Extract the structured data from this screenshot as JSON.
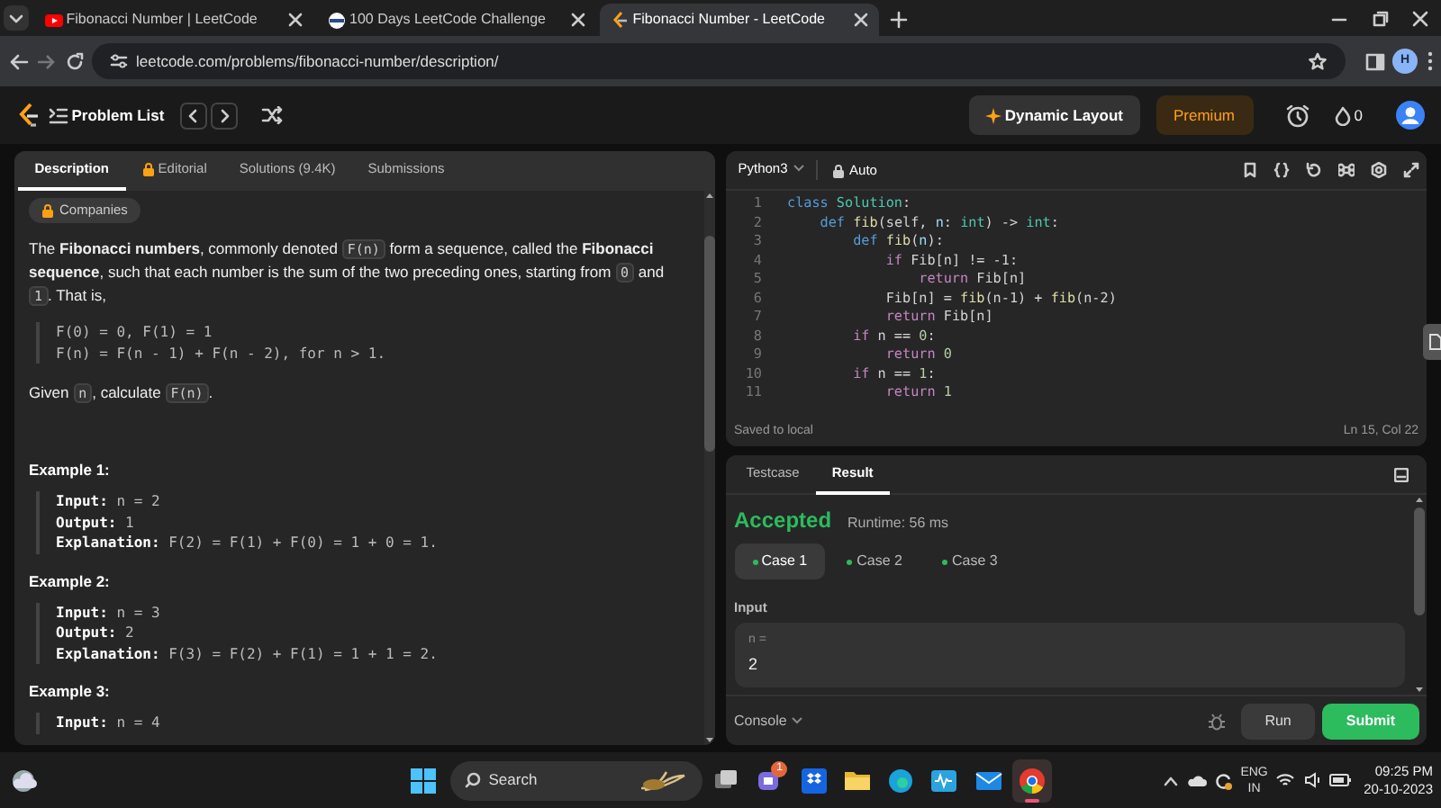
{
  "browser": {
    "tabs": [
      {
        "title": "Fibonacci Number | LeetCode",
        "kind": "video",
        "selected": false
      },
      {
        "title": "100 Days LeetCode Challenge",
        "kind": "globe",
        "selected": false
      },
      {
        "title": "Fibonacci Number - LeetCode",
        "kind": "leetcode",
        "selected": true
      }
    ],
    "url": "leetcode.com/problems/fibonacci-number/description/",
    "profile": "H"
  },
  "header": {
    "problem_list": "Problem List",
    "dynamic_layout": "Dynamic Layout",
    "premium": "Premium",
    "streak": "0"
  },
  "description": {
    "tabs": [
      {
        "label": "Description",
        "locked": false,
        "selected": true
      },
      {
        "label": "Editorial",
        "locked": true,
        "selected": false
      },
      {
        "label": "Solutions (9.4K)",
        "locked": false,
        "selected": false
      },
      {
        "label": "Submissions",
        "locked": false,
        "selected": false
      }
    ],
    "companies": "Companies",
    "intro": [
      {
        "kind": "text",
        "text": "The **Fibonacci numbers**, commonly denoted "
      },
      {
        "kind": "code",
        "text": "F(n)"
      },
      {
        "kind": "text",
        "text": " form a sequence, called the **Fibonacci sequence**, such that each number is the sum of the two preceding ones, starting from "
      },
      {
        "kind": "code",
        "text": "0"
      },
      {
        "kind": "text",
        "text": " and "
      },
      {
        "kind": "code",
        "text": "1"
      },
      {
        "kind": "text",
        "text": ". That is,"
      }
    ],
    "formula": [
      "F(0) = 0, F(1) = 1",
      "F(n) = F(n - 1) + F(n - 2), for n > 1."
    ],
    "given": [
      {
        "kind": "text",
        "text": "Given "
      },
      {
        "kind": "code",
        "text": "n"
      },
      {
        "kind": "text",
        "text": ", calculate "
      },
      {
        "kind": "code",
        "text": "F(n)"
      },
      {
        "kind": "text",
        "text": "."
      }
    ],
    "examples": [
      {
        "title": "Example 1:",
        "lines": [
          {
            "label": "Input:",
            "value": "n = 2"
          },
          {
            "label": "Output:",
            "value": "1"
          },
          {
            "label": "Explanation:",
            "value": "F(2) = F(1) + F(0) = 1 + 0 = 1."
          }
        ]
      },
      {
        "title": "Example 2:",
        "lines": [
          {
            "label": "Input:",
            "value": "n = 3"
          },
          {
            "label": "Output:",
            "value": "2"
          },
          {
            "label": "Explanation:",
            "value": "F(3) = F(2) + F(1) = 1 + 1 = 2."
          }
        ]
      },
      {
        "title": "Example 3:",
        "lines": [
          {
            "label": "Input:",
            "value": "n = 4"
          }
        ]
      }
    ]
  },
  "editor": {
    "language": "Python3",
    "mode": "Auto",
    "lines": [
      {
        "number": "1",
        "tokens": [
          {
            "kind": "storage",
            "text": "class"
          },
          {
            "kind": "class",
            "text": " Solution"
          },
          {
            "kind": "plain",
            "text": ":"
          }
        ]
      },
      {
        "number": "2",
        "tokens": [
          {
            "kind": "storage",
            "text": "    def"
          },
          {
            "kind": "func",
            "text": " fib"
          },
          {
            "kind": "plain",
            "text": "(self, "
          },
          {
            "kind": "var",
            "text": "n"
          },
          {
            "kind": "plain",
            "text": ": "
          },
          {
            "kind": "class",
            "text": "int"
          },
          {
            "kind": "plain",
            "text": ") -> "
          },
          {
            "kind": "class",
            "text": "int"
          },
          {
            "kind": "plain",
            "text": ":"
          }
        ]
      },
      {
        "number": "3",
        "tokens": [
          {
            "kind": "storage",
            "text": "        def"
          },
          {
            "kind": "func",
            "text": " fib"
          },
          {
            "kind": "plain",
            "text": "("
          },
          {
            "kind": "var",
            "text": "n"
          },
          {
            "kind": "plain",
            "text": "):"
          }
        ]
      },
      {
        "number": "4",
        "tokens": [
          {
            "kind": "control",
            "text": "            if"
          },
          {
            "kind": "plain",
            "text": " Fib[n] != -1:"
          }
        ]
      },
      {
        "number": "5",
        "tokens": [
          {
            "kind": "control",
            "text": "                return"
          },
          {
            "kind": "plain",
            "text": " Fib[n]"
          }
        ]
      },
      {
        "number": "6",
        "tokens": [
          {
            "kind": "plain",
            "text": "            Fib[n] = "
          },
          {
            "kind": "func",
            "text": "fib"
          },
          {
            "kind": "plain",
            "text": "(n-1) + "
          },
          {
            "kind": "func",
            "text": "fib"
          },
          {
            "kind": "plain",
            "text": "(n-2)"
          }
        ]
      },
      {
        "number": "7",
        "tokens": [
          {
            "kind": "control",
            "text": "            return"
          },
          {
            "kind": "plain",
            "text": " Fib[n]"
          }
        ]
      },
      {
        "number": "8",
        "tokens": [
          {
            "kind": "control",
            "text": "        if"
          },
          {
            "kind": "plain",
            "text": " n == "
          },
          {
            "kind": "num",
            "text": "0"
          },
          {
            "kind": "plain",
            "text": ":"
          }
        ]
      },
      {
        "number": "9",
        "tokens": [
          {
            "kind": "control",
            "text": "            return"
          },
          {
            "kind": "num",
            "text": " 0"
          }
        ]
      },
      {
        "number": "10",
        "tokens": [
          {
            "kind": "control",
            "text": "        if"
          },
          {
            "kind": "plain",
            "text": " n == "
          },
          {
            "kind": "num",
            "text": "1"
          },
          {
            "kind": "plain",
            "text": ":"
          }
        ]
      },
      {
        "number": "11",
        "tokens": [
          {
            "kind": "control",
            "text": "            return"
          },
          {
            "kind": "num",
            "text": " 1"
          }
        ]
      }
    ],
    "saved": "Saved to local",
    "position": "Ln 15, Col 22"
  },
  "result": {
    "tabs": [
      {
        "label": "Testcase",
        "selected": false
      },
      {
        "label": "Result",
        "selected": true
      }
    ],
    "status": "Accepted",
    "runtime": "Runtime: 56 ms",
    "cases": [
      {
        "label": "Case 1",
        "selected": true
      },
      {
        "label": "Case 2",
        "selected": false
      },
      {
        "label": "Case 3",
        "selected": false
      }
    ],
    "input_label": "Input",
    "input_name": "n =",
    "input_value": "2",
    "console": "Console",
    "run": "Run",
    "submit": "Submit"
  },
  "taskbar": {
    "search": "Search",
    "apps": [
      {
        "kind": "taskview",
        "selected": false
      },
      {
        "kind": "chat",
        "selected": false,
        "badge": "1"
      },
      {
        "kind": "dropbox",
        "selected": false
      },
      {
        "kind": "folder",
        "selected": false
      },
      {
        "kind": "edge",
        "selected": false
      },
      {
        "kind": "wave",
        "selected": false
      },
      {
        "kind": "mail",
        "selected": false
      },
      {
        "kind": "chrome",
        "selected": true
      }
    ],
    "lang": "ENG",
    "region": "IN",
    "time": "09:25 PM",
    "date": "20-10-2023"
  }
}
